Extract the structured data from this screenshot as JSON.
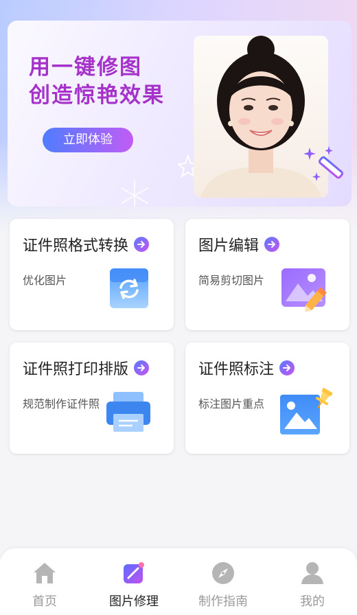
{
  "banner": {
    "title_line1": "用一键修图",
    "title_line2": "创造惊艳效果",
    "cta_label": "立即体验"
  },
  "cards": [
    {
      "title": "证件照格式转换",
      "subtitle": "优化图片",
      "icon": "convert-icon"
    },
    {
      "title": "图片编辑",
      "subtitle": "简易剪切图片",
      "icon": "image-edit-icon"
    },
    {
      "title": "证件照打印排版",
      "subtitle": "规范制作证件照",
      "icon": "printer-icon"
    },
    {
      "title": "证件照标注",
      "subtitle": "标注图片重点",
      "icon": "image-pin-icon"
    }
  ],
  "tabbar": {
    "items": [
      {
        "label": "首页",
        "icon": "home-icon",
        "active": false
      },
      {
        "label": "图片修理",
        "icon": "photo-edit-icon",
        "active": true
      },
      {
        "label": "制作指南",
        "icon": "compass-icon",
        "active": false
      },
      {
        "label": "我的",
        "icon": "user-icon",
        "active": false
      }
    ]
  },
  "colors": {
    "brand_purple": "#a533c9",
    "gradient_start": "#4f7dff",
    "gradient_end": "#c15cf5",
    "tab_active": "#222222",
    "tab_inactive": "#9a9a9a"
  }
}
